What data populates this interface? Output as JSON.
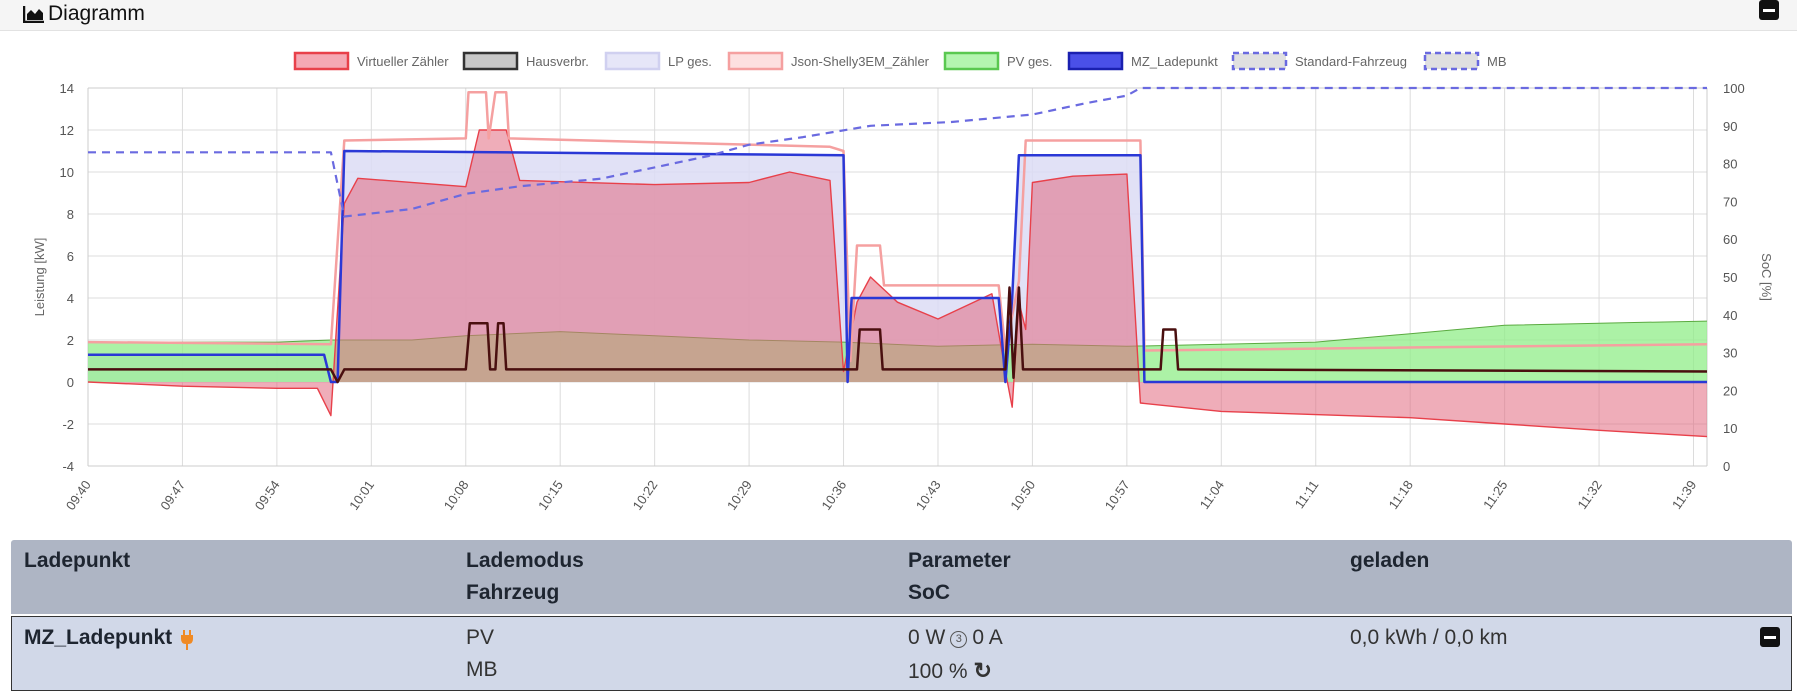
{
  "header": {
    "title": "Diagramm"
  },
  "table": {
    "headers": {
      "ladepunkt": "Ladepunkt",
      "lademodus": "Lademodus",
      "fahrzeug": "Fahrzeug",
      "parameter": "Parameter",
      "soc": "SoC",
      "geladen": "geladen"
    },
    "row": {
      "name": "MZ_Ladepunkt",
      "mode": "PV",
      "vehicle": "MB",
      "power": "0 W",
      "phases": "3",
      "current": "0 A",
      "soc": "100 %",
      "charged": "0,0 kWh / 0,0 km"
    }
  },
  "colors": {
    "virtual_meter": "#f28b96",
    "house": "#5a1a1a",
    "lp_total": "#e0e0f8",
    "shelly": "#f5a0a0",
    "pv": "#a8f0a0",
    "mz_ladepunkt": "#2f3ad8",
    "soc_line": "#6a6ae0",
    "plug_accent": "#f08a24"
  },
  "chart_data": {
    "type": "area",
    "ylabel": "Leistung [kW]",
    "y2label": "SoC [%]",
    "ylim": [
      -4,
      14
    ],
    "y2lim": [
      0,
      100
    ],
    "yticks": [
      -4,
      -2,
      0,
      2,
      4,
      6,
      8,
      10,
      12,
      14
    ],
    "y2ticks": [
      0,
      10,
      20,
      30,
      40,
      50,
      60,
      70,
      80,
      90,
      100
    ],
    "xticks": [
      "09:40",
      "09:47",
      "09:54",
      "10:01",
      "10:08",
      "10:15",
      "10:22",
      "10:29",
      "10:36",
      "10:43",
      "10:50",
      "10:57",
      "11:04",
      "11:11",
      "11:18",
      "11:25",
      "11:32",
      "11:39"
    ],
    "xlim": [
      "09:40",
      "11:40"
    ],
    "grid": true,
    "legend_position": "top",
    "series": [
      {
        "name": "Virtueller Zähler",
        "axis": "left",
        "style": "area",
        "color": "#f5a8b4",
        "points": [
          [
            "09:40",
            0
          ],
          [
            "09:47",
            -0.2
          ],
          [
            "09:54",
            -0.3
          ],
          [
            "09:57",
            -0.3
          ],
          [
            "09:58",
            -1.6
          ],
          [
            "09:59",
            8.5
          ],
          [
            "10:00",
            9.7
          ],
          [
            "10:08",
            9.3
          ],
          [
            "10:09",
            12.0
          ],
          [
            "10:11",
            12.0
          ],
          [
            "10:12",
            9.6
          ],
          [
            "10:22",
            9.4
          ],
          [
            "10:29",
            9.5
          ],
          [
            "10:32",
            10.0
          ],
          [
            "10:35",
            9.6
          ],
          [
            "10:36",
            0.5
          ],
          [
            "10:37",
            3.8
          ],
          [
            "10:38",
            5.0
          ],
          [
            "10:40",
            3.8
          ],
          [
            "10:43",
            3.0
          ],
          [
            "10:47",
            4.2
          ],
          [
            "10:48",
            0.5
          ],
          [
            "10:48.5",
            -1.2
          ],
          [
            "10:49",
            3.8
          ],
          [
            "10:49.5",
            2.5
          ],
          [
            "10:50",
            9.5
          ],
          [
            "10:53",
            9.8
          ],
          [
            "10:57",
            9.9
          ],
          [
            "10:58",
            -1.0
          ],
          [
            "11:04",
            -1.4
          ],
          [
            "11:18",
            -1.7
          ],
          [
            "11:25",
            -2.0
          ],
          [
            "11:32",
            -2.3
          ],
          [
            "11:40",
            -2.6
          ]
        ]
      },
      {
        "name": "Hausverbr.",
        "axis": "left",
        "style": "line",
        "color": "#4a0f0f",
        "points": [
          [
            "09:40",
            0.6
          ],
          [
            "09:58",
            0.6
          ],
          [
            "09:58.5",
            0.0
          ],
          [
            "09:59",
            0.6
          ],
          [
            "10:08",
            0.6
          ],
          [
            "10:08.3",
            2.8
          ],
          [
            "10:09.6",
            2.8
          ],
          [
            "10:09.8",
            0.6
          ],
          [
            "10:10.2",
            0.6
          ],
          [
            "10:10.4",
            2.8
          ],
          [
            "10:10.8",
            2.8
          ],
          [
            "10:11",
            0.6
          ],
          [
            "10:37",
            0.6
          ],
          [
            "10:37.2",
            2.5
          ],
          [
            "10:38.7",
            2.5
          ],
          [
            "10:38.9",
            0.6
          ],
          [
            "10:48",
            0.6
          ],
          [
            "10:48.3",
            4.5
          ],
          [
            "10:48.6",
            0.2
          ],
          [
            "10:49",
            4.5
          ],
          [
            "10:49.3",
            0.6
          ],
          [
            "10:58",
            0.6
          ],
          [
            "10:59.5",
            0.6
          ],
          [
            "10:59.7",
            2.5
          ],
          [
            "11:00.6",
            2.5
          ],
          [
            "11:00.8",
            0.6
          ],
          [
            "11:40",
            0.5
          ]
        ]
      },
      {
        "name": "LP ges.",
        "axis": "left",
        "style": "area",
        "color": "#dcdcf5",
        "points": [
          [
            "09:40",
            1.3
          ],
          [
            "09:57.5",
            1.3
          ],
          [
            "09:58",
            0.0
          ],
          [
            "09:58.5",
            0.0
          ],
          [
            "09:59",
            11.0
          ],
          [
            "10:36",
            10.8
          ],
          [
            "10:36.3",
            0.0
          ],
          [
            "10:36.6",
            4.0
          ],
          [
            "10:47.5",
            4.0
          ],
          [
            "10:48",
            0.0
          ],
          [
            "10:48.5",
            4.0
          ],
          [
            "10:49",
            10.8
          ],
          [
            "10:58",
            10.8
          ],
          [
            "10:58.3",
            0.0
          ],
          [
            "11:40",
            0.0
          ]
        ]
      },
      {
        "name": "Json-Shelly3EM_Zähler",
        "axis": "left",
        "style": "line",
        "color": "#f5a0a0",
        "points": [
          [
            "09:40",
            1.9
          ],
          [
            "09:58",
            1.8
          ],
          [
            "09:59",
            11.5
          ],
          [
            "10:08",
            11.6
          ],
          [
            "10:08.2",
            13.8
          ],
          [
            "10:09.5",
            13.8
          ],
          [
            "10:09.7",
            11.6
          ],
          [
            "10:10.2",
            13.8
          ],
          [
            "10:11",
            13.8
          ],
          [
            "10:11.2",
            11.6
          ],
          [
            "10:35",
            11.2
          ],
          [
            "10:36",
            11.0
          ],
          [
            "10:36.5",
            1.0
          ],
          [
            "10:37",
            6.5
          ],
          [
            "10:38.7",
            6.5
          ],
          [
            "10:39",
            4.6
          ],
          [
            "10:47.5",
            4.6
          ],
          [
            "10:48",
            1.5
          ],
          [
            "10:49",
            4.8
          ],
          [
            "10:49.5",
            11.5
          ],
          [
            "10:58",
            11.5
          ],
          [
            "10:58.3",
            1.5
          ],
          [
            "11:40",
            1.8
          ]
        ]
      },
      {
        "name": "PV ges.",
        "axis": "left",
        "style": "area",
        "color": "#b4f5b0",
        "points": [
          [
            "09:40",
            1.9
          ],
          [
            "09:54",
            1.9
          ],
          [
            "09:58",
            2.0
          ],
          [
            "10:04",
            2.0
          ],
          [
            "10:08",
            2.2
          ],
          [
            "10:15",
            2.4
          ],
          [
            "10:22",
            2.2
          ],
          [
            "10:29",
            2.0
          ],
          [
            "10:36",
            1.9
          ],
          [
            "10:43",
            1.7
          ],
          [
            "10:50",
            1.8
          ],
          [
            "10:57",
            1.7
          ],
          [
            "11:04",
            1.8
          ],
          [
            "11:11",
            1.9
          ],
          [
            "11:18",
            2.3
          ],
          [
            "11:25",
            2.7
          ],
          [
            "11:32",
            2.8
          ],
          [
            "11:40",
            2.9
          ]
        ]
      },
      {
        "name": "MZ_Ladepunkt",
        "axis": "left",
        "style": "line",
        "color": "#2a38d6",
        "points": [
          [
            "09:40",
            1.3
          ],
          [
            "09:57.5",
            1.3
          ],
          [
            "09:58",
            0.0
          ],
          [
            "09:58.5",
            0.0
          ],
          [
            "09:59",
            11.0
          ],
          [
            "10:36",
            10.8
          ],
          [
            "10:36.3",
            0.0
          ],
          [
            "10:36.6",
            4.0
          ],
          [
            "10:47.5",
            4.0
          ],
          [
            "10:48",
            0.0
          ],
          [
            "10:48.5",
            4.0
          ],
          [
            "10:49",
            10.8
          ],
          [
            "10:58",
            10.8
          ],
          [
            "10:58.3",
            0.0
          ],
          [
            "11:40",
            0.0
          ]
        ]
      },
      {
        "name": "Standard-Fahrzeug",
        "axis": "right",
        "style": "dashed",
        "color": "#6a6ae0",
        "points": []
      },
      {
        "name": "MB",
        "axis": "right",
        "style": "dashed",
        "color": "#6a6ae0",
        "points": [
          [
            "09:40",
            83
          ],
          [
            "09:58",
            83
          ],
          [
            "09:59",
            66
          ],
          [
            "10:04",
            68
          ],
          [
            "10:08",
            72
          ],
          [
            "10:12",
            74
          ],
          [
            "10:18",
            76
          ],
          [
            "10:22",
            79
          ],
          [
            "10:26",
            82
          ],
          [
            "10:29",
            85
          ],
          [
            "10:33",
            87
          ],
          [
            "10:38",
            90
          ],
          [
            "10:44",
            91
          ],
          [
            "10:50",
            93
          ],
          [
            "10:54",
            96
          ],
          [
            "10:57",
            98
          ],
          [
            "10:58",
            100
          ],
          [
            "11:40",
            100
          ]
        ]
      }
    ]
  }
}
